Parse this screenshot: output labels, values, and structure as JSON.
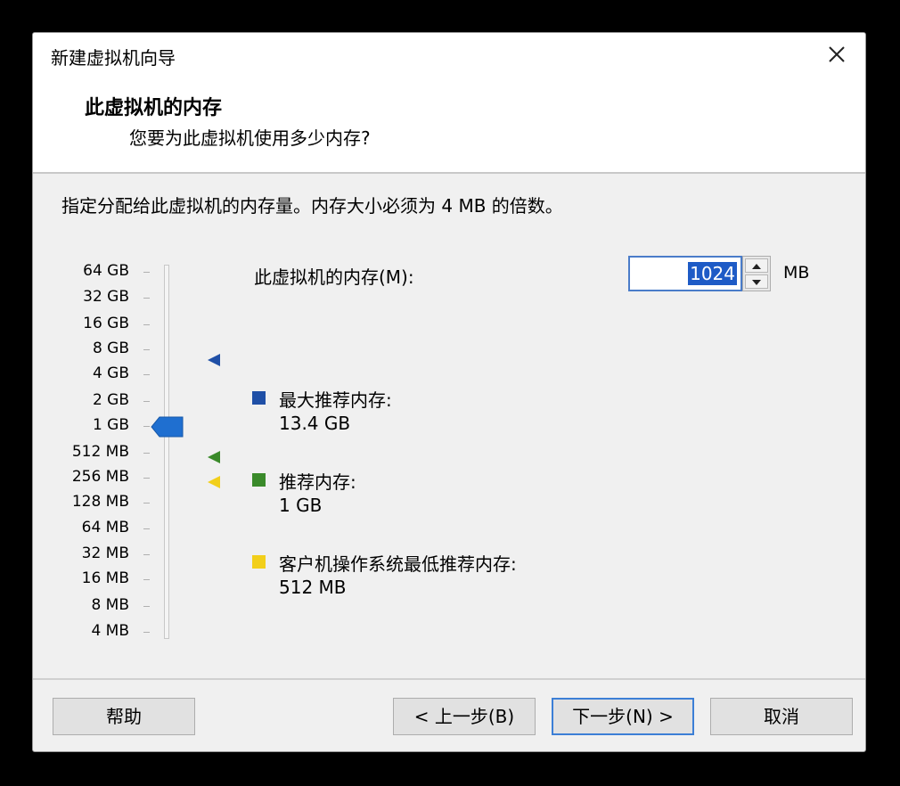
{
  "window": {
    "title": "新建虚拟机向导",
    "close_icon": "close-icon"
  },
  "header": {
    "title": "此虚拟机的内存",
    "subtitle": "您要为此虚拟机使用多少内存?"
  },
  "content": {
    "instruction": "指定分配给此虚拟机的内存量。内存大小必须为 4 MB 的倍数。",
    "scale_labels": [
      "64 GB",
      "32 GB",
      "16 GB",
      "8 GB",
      "4 GB",
      "2 GB",
      "1 GB",
      "512 MB",
      "256 MB",
      "128 MB",
      "64 MB",
      "32 MB",
      "16 MB",
      "8 MB",
      "4 MB"
    ],
    "memory_label": "此虚拟机的内存(M):",
    "memory_value": "1024",
    "memory_unit": "MB",
    "legend": {
      "max": {
        "title": "最大推荐内存:",
        "value": "13.4 GB",
        "color": "#1f4fa6"
      },
      "recommended": {
        "title": "推荐内存:",
        "value": "1 GB",
        "color": "#3a8a2a"
      },
      "min": {
        "title": "客户机操作系统最低推荐内存:",
        "value": "512 MB",
        "color": "#f2cf1a"
      }
    },
    "slider_thumb_color": "#1f6fd0"
  },
  "footer": {
    "help": "帮助",
    "back": "< 上一步(B)",
    "next": "下一步(N) >",
    "cancel": "取消"
  }
}
